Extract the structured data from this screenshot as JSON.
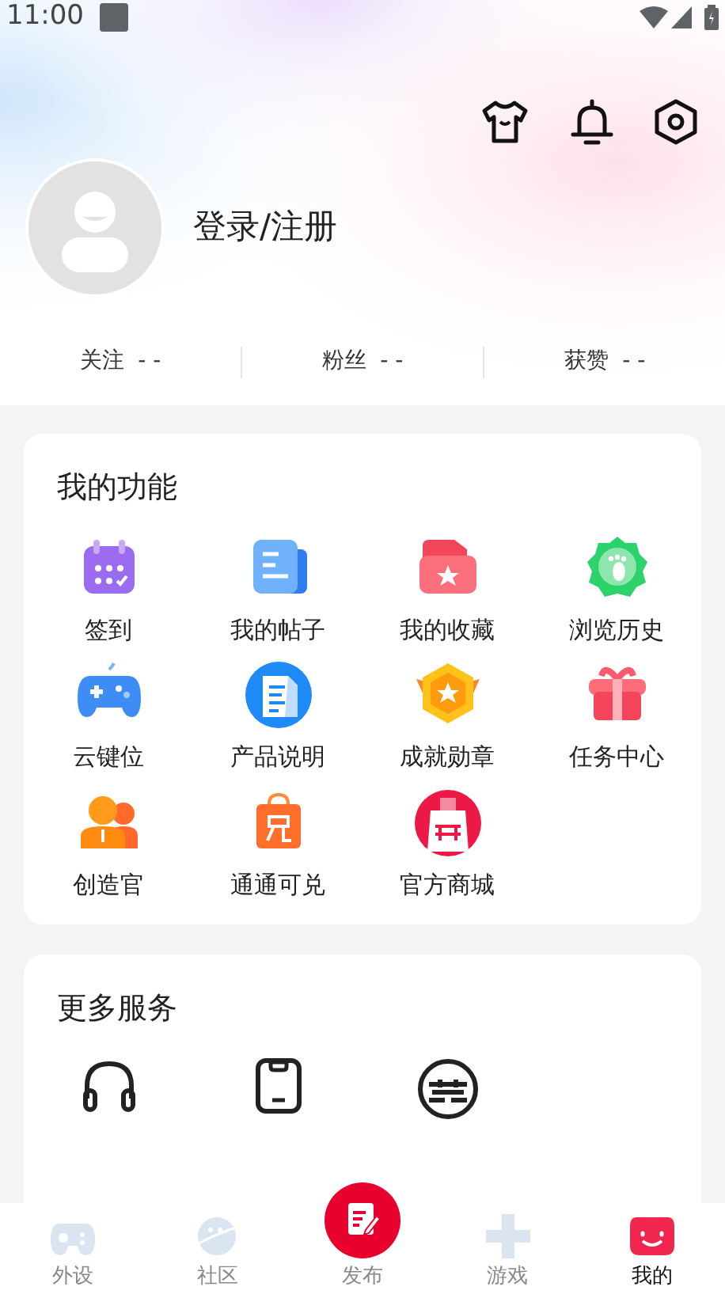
{
  "status_bar": {
    "time": "11:00"
  },
  "profile": {
    "login": "登录/注册"
  },
  "stats": [
    {
      "label": "关注",
      "value": "- -"
    },
    {
      "label": "粉丝",
      "value": "- -"
    },
    {
      "label": "获赞",
      "value": "- -"
    }
  ],
  "features": {
    "title": "我的功能",
    "items": [
      {
        "label": "签到"
      },
      {
        "label": "我的帖子"
      },
      {
        "label": "我的收藏"
      },
      {
        "label": "浏览历史"
      },
      {
        "label": "云键位"
      },
      {
        "label": "产品说明"
      },
      {
        "label": "成就勋章"
      },
      {
        "label": "任务中心"
      },
      {
        "label": "创造官"
      },
      {
        "label": "通通可兑"
      },
      {
        "label": "官方商城"
      }
    ]
  },
  "services": {
    "title": "更多服务"
  },
  "tabs": [
    {
      "label": "外设",
      "selected": false
    },
    {
      "label": "社区",
      "selected": false
    },
    {
      "label": "发布",
      "selected": false
    },
    {
      "label": "游戏",
      "selected": false
    },
    {
      "label": "我的",
      "selected": true
    }
  ]
}
